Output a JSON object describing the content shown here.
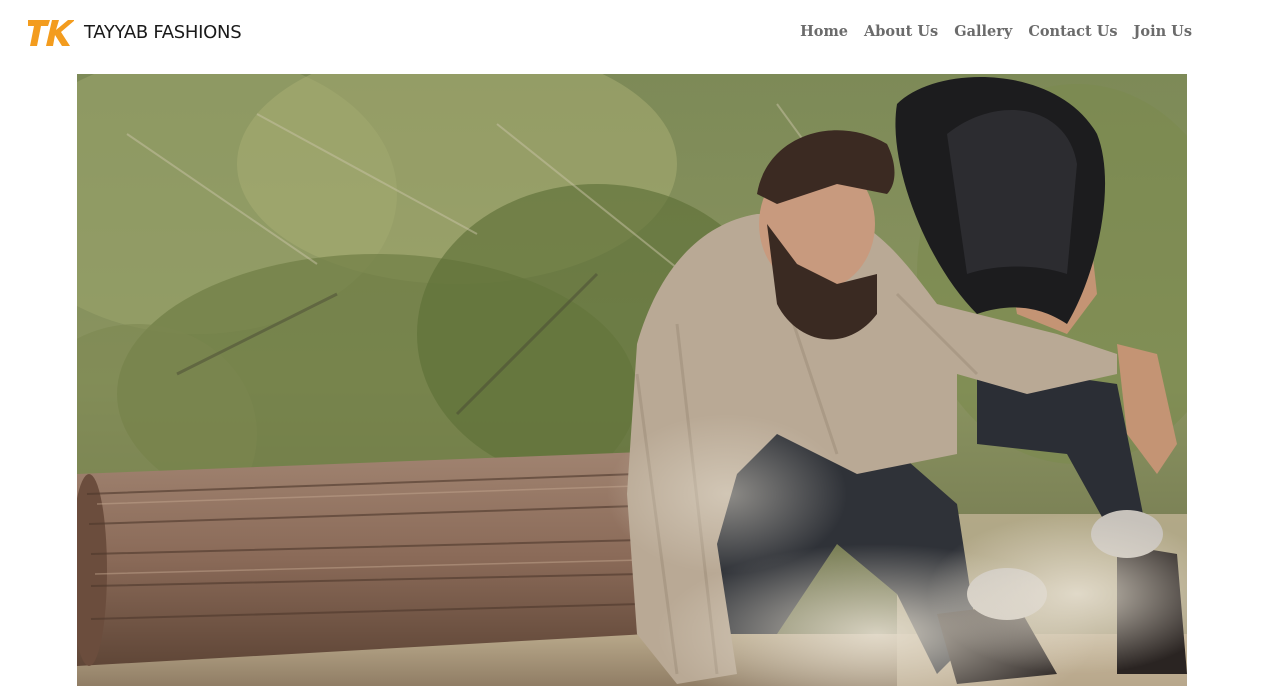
{
  "brand": {
    "name": "TAYYAB FASHIONS",
    "logo_icon": "tk-monogram-icon",
    "logo_color": "#f39c1e"
  },
  "nav": {
    "items": [
      {
        "label": "Home"
      },
      {
        "label": "About Us"
      },
      {
        "label": "Gallery"
      },
      {
        "label": "Contact Us"
      },
      {
        "label": "Join Us"
      }
    ]
  },
  "hero": {
    "image": "bearded-man-sitting-by-log-with-hat-photo"
  },
  "colors": {
    "nav_text": "#6b6b6b",
    "brand_text": "#1a1a1a",
    "background": "#ffffff"
  }
}
